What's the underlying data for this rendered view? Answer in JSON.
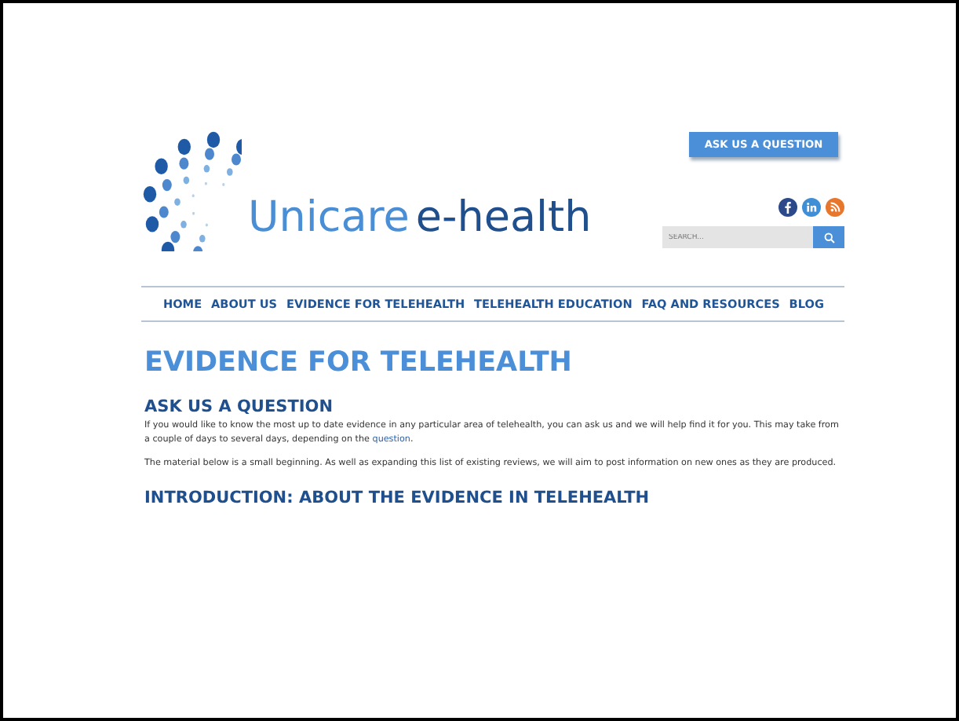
{
  "header": {
    "logo_text": [
      "Unicare",
      "e-health"
    ],
    "ask_button": "ASK US A QUESTION",
    "search": {
      "placeholder": "SEARCH..."
    }
  },
  "nav": [
    {
      "label": "HOME",
      "selected": false
    },
    {
      "label": "ABOUT US",
      "selected": false
    },
    {
      "label": "EVIDENCE FOR TELEHEALTH",
      "selected": false
    },
    {
      "label": "TELEHEALTH EDUCATION",
      "selected": false
    },
    {
      "label": "FAQ AND RESOURCES",
      "selected": false
    },
    {
      "label": "BLOG",
      "selected": false
    }
  ],
  "content": {
    "title": "EVIDENCE FOR TELEHEALTH",
    "section_heading": "ASK US A QUESTION",
    "paragraph_1": {
      "text": "If you would like to know the most up to date evidence in any particular area of telehealth, you can ask us and we will help find it for you. This may take from a couple of days to several days, depending on the ",
      "link": "question",
      "after": "."
    },
    "paragraph_2": "The material below is a small beginning. As well as expanding this list of existing reviews, we will aim to post information on new ones as they are produced.",
    "subheading": "INTRODUCTION: ABOUT THE EVIDENCE IN TELEHEALTH"
  }
}
